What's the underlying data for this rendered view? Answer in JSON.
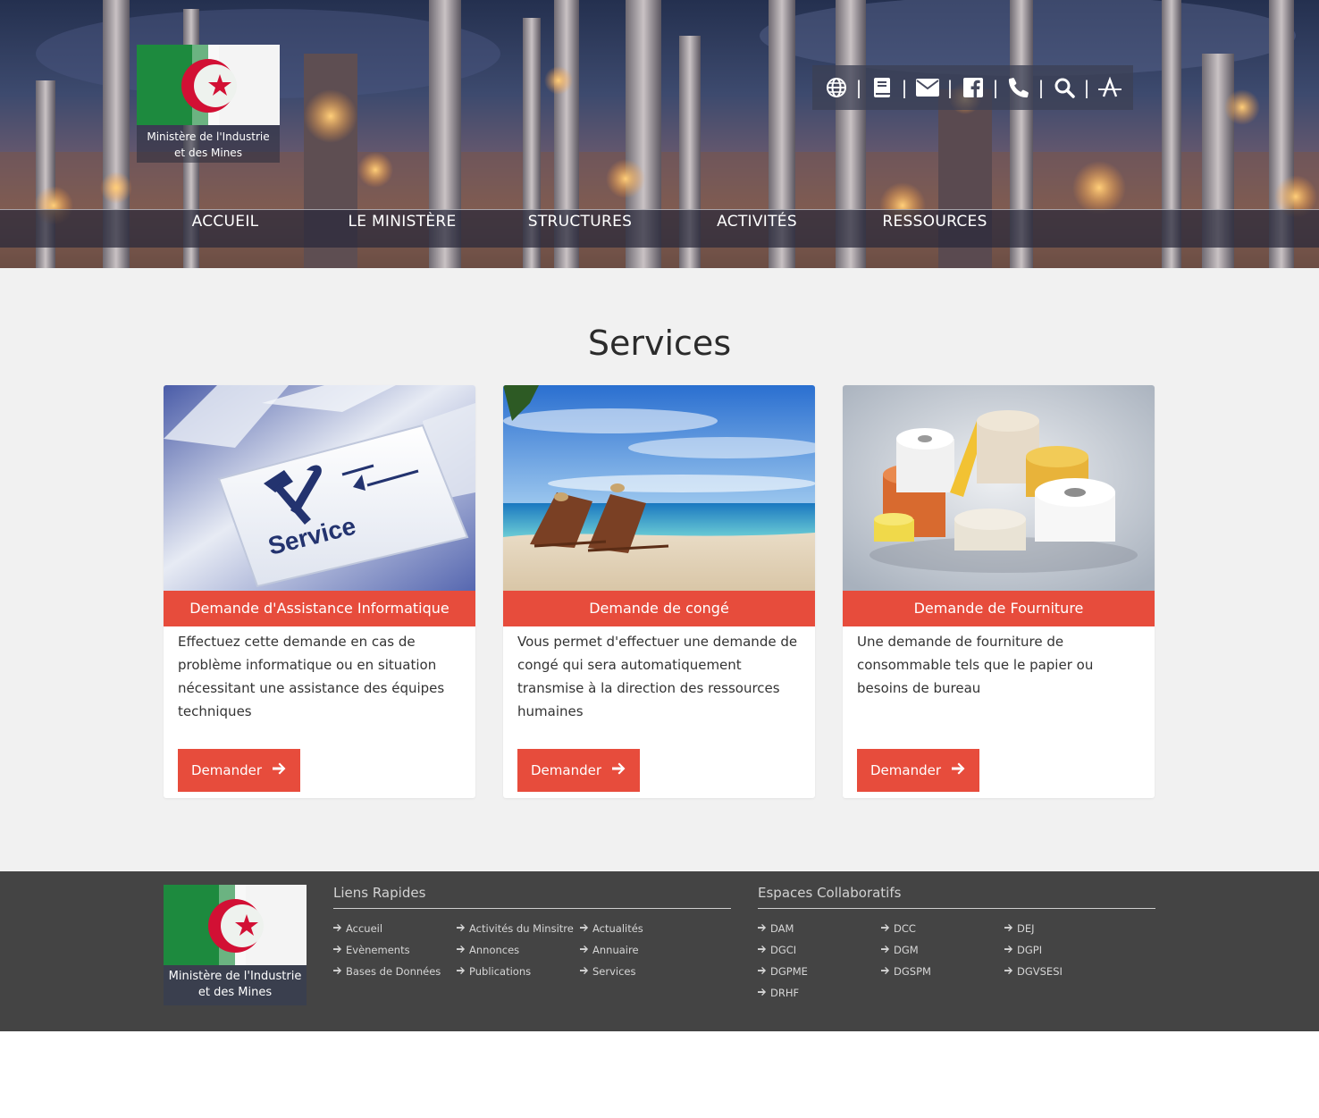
{
  "header": {
    "logo_caption_line1": "Ministère de l'Industrie",
    "logo_caption_line2": "et des Mines",
    "toolbar_icons": [
      "globe-icon",
      "book-icon",
      "envelope-icon",
      "facebook-icon",
      "phone-icon",
      "search-icon",
      "font-size-icon"
    ],
    "toolbar_separator": "|"
  },
  "nav": {
    "items": [
      {
        "label": "ACCUEIL"
      },
      {
        "label": "LE MINISTÈRE"
      },
      {
        "label": "STRUCTURES"
      },
      {
        "label": "ACTIVITÉS"
      },
      {
        "label": "RESSOURCES"
      }
    ]
  },
  "main": {
    "title": "Services",
    "cards": [
      {
        "title": "Demande d'Assistance Informatique",
        "text": "Effectuez cette demande en cas de problème informatique ou en situation nécessitant une assistance des équipes techniques",
        "button": "Demander",
        "image_text": "Service"
      },
      {
        "title": "Demande de congé",
        "text": "Vous permet d'effectuer une demande de congé qui sera automatiquement transmise à la direction des ressources humaines",
        "button": "Demander"
      },
      {
        "title": "Demande de Fourniture",
        "text": "Une demande de fourniture de consommable tels que le papier ou besoins de bureau",
        "button": "Demander"
      }
    ]
  },
  "footer": {
    "logo_caption_line1": "Ministère de l'Industrie",
    "logo_caption_line2": "et des Mines",
    "quick_links_title": "Liens Rapides",
    "quick_links": [
      "Accueil",
      "Activités du Minsitre",
      "Actualités",
      "Evènements",
      "Annonces",
      "Annuaire",
      "Bases de Données",
      "Publications",
      "Services"
    ],
    "collab_title": "Espaces Collaboratifs",
    "collab_links": [
      "DAM",
      "DCC",
      "DEJ",
      "DGCI",
      "DGM",
      "DGPI",
      "DGPME",
      "DGSPM",
      "DGVSESI",
      "DRHF"
    ]
  },
  "colors": {
    "accent": "#e74c3c",
    "main_bg": "#f1f1f1",
    "footer_bg": "#444444"
  }
}
